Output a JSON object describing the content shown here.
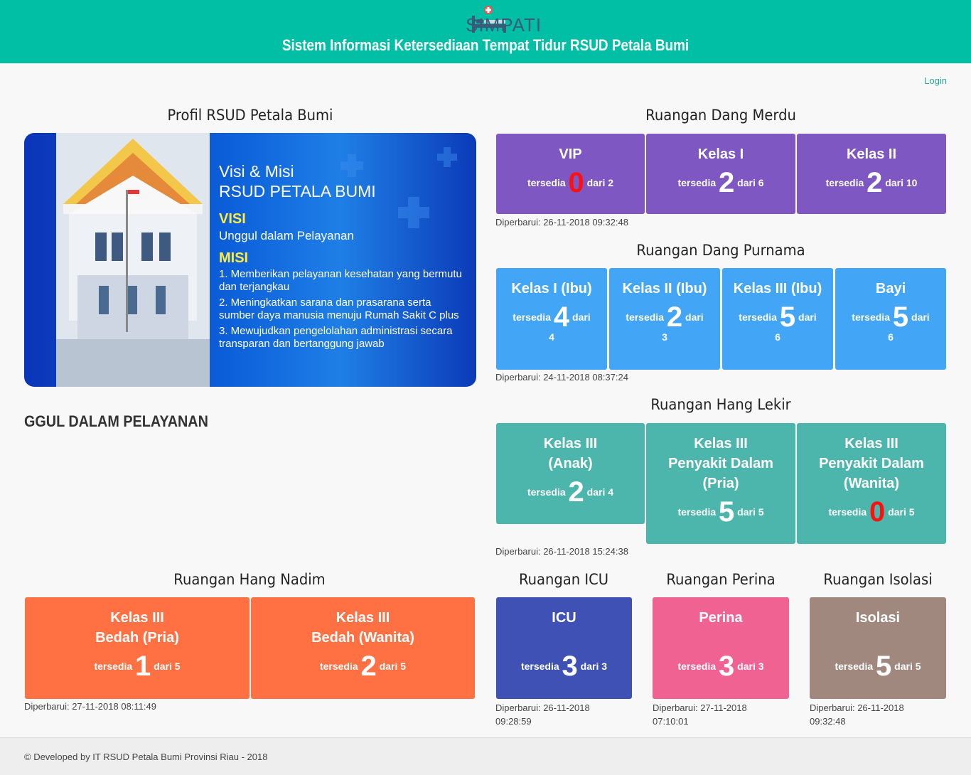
{
  "header": {
    "logo_text": "SIMPATI",
    "title": "Sistem Informasi Ketersediaan Tempat Tidur RSUD Petala Bumi"
  },
  "login_label": "Login",
  "profile": {
    "title": "Profil RSUD Petala Bumi",
    "heading1": "Visi & Misi",
    "heading2": "RSUD PETALA BUMI",
    "visi_label": "VISI",
    "visi_text": "Unggul dalam Pelayanan",
    "misi_label": "MISI",
    "misi_items": [
      "1. Memberikan pelayanan kesehatan yang bermutu dan terjangkau",
      "2. Meningkatkan sarana dan prasarana serta sumber daya manusia menuju Rumah Sakit C plus",
      "3. Mewujudkan pengelolahan administrasi secara transparan dan bertanggung jawab"
    ],
    "marquee": "GGUL DALAM PELAYANAN"
  },
  "labels": {
    "available": "tersedia",
    "of": "dari",
    "updated": "Diperbarui:"
  },
  "sections": {
    "dang_merdu": {
      "title": "Ruangan Dang Merdu",
      "updated": "Diperbarui: 26-11-2018 09:32:48",
      "color": "#7e57c2",
      "rooms": [
        {
          "name": "VIP",
          "available": "0",
          "total": "dari 2"
        },
        {
          "name": "Kelas I",
          "available": "2",
          "total": "dari 6"
        },
        {
          "name": "Kelas II",
          "available": "2",
          "total": "dari 10"
        }
      ]
    },
    "dang_purnama": {
      "title": "Ruangan Dang Purnama",
      "updated": "Diperbarui: 24-11-2018 08:37:24",
      "color": "#42a5f5",
      "rooms": [
        {
          "name": "Kelas I (Ibu)",
          "available": "4",
          "total": "4"
        },
        {
          "name": "Kelas II (Ibu)",
          "available": "2",
          "total": "3"
        },
        {
          "name": "Kelas III (Ibu)",
          "available": "5",
          "total": "6"
        },
        {
          "name": "Bayi",
          "available": "5",
          "total": "6"
        }
      ]
    },
    "hang_lekir": {
      "title": "Ruangan Hang Lekir",
      "updated": "Diperbarui: 26-11-2018 15:24:38",
      "color": "#4db6ac",
      "rooms": [
        {
          "name": "Kelas III\n(Anak)",
          "available": "2",
          "total": "dari 4"
        },
        {
          "name": "Kelas III\nPenyakit Dalam\n(Pria)",
          "available": "5",
          "total": "dari 5"
        },
        {
          "name": "Kelas III\nPenyakit Dalam\n(Wanita)",
          "available": "0",
          "total": "dari 5"
        }
      ]
    },
    "hang_nadim": {
      "title": "Ruangan Hang Nadim",
      "updated": "Diperbarui: 27-11-2018 08:11:49",
      "color": "#ff7043",
      "rooms": [
        {
          "name": "Kelas III\nBedah (Pria)",
          "available": "1",
          "total": "dari 5"
        },
        {
          "name": "Kelas III\nBedah (Wanita)",
          "available": "2",
          "total": "dari 5"
        }
      ]
    },
    "icu": {
      "title": "Ruangan ICU",
      "updated_line1": "Diperbarui: 26-11-2018",
      "updated_line2": "09:28:59",
      "color": "#3f51b5",
      "room": {
        "name": "ICU",
        "available": "3",
        "total": "dari 3"
      }
    },
    "perina": {
      "title": "Ruangan Perina",
      "updated_line1": "Diperbarui: 27-11-2018",
      "updated_line2": "07:10:01",
      "color": "#f06292",
      "room": {
        "name": "Perina",
        "available": "3",
        "total": "dari 3"
      }
    },
    "isolasi": {
      "title": "Ruangan Isolasi",
      "updated_line1": "Diperbarui: 26-11-2018",
      "updated_line2": "09:32:48",
      "color": "#a1887f",
      "room": {
        "name": "Isolasi",
        "available": "5",
        "total": "dari 5"
      }
    }
  },
  "footer": "© Developed by IT RSUD Petala Bumi Provinsi Riau - 2018"
}
